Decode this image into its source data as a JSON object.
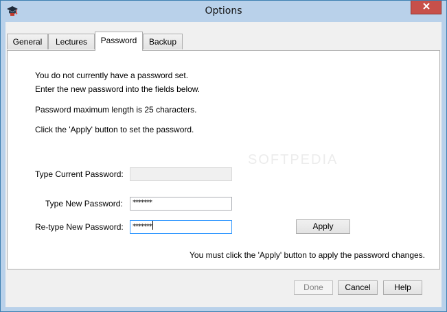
{
  "window": {
    "title": "Options",
    "close_icon": "close-icon",
    "app_icon": "graduation-cap-icon"
  },
  "tabs": [
    {
      "label": "General",
      "active": false
    },
    {
      "label": "Lectures",
      "active": false
    },
    {
      "label": "Password",
      "active": true
    },
    {
      "label": "Backup",
      "active": false
    }
  ],
  "password_page": {
    "info_line1": "You do not currently have a password set.",
    "info_line2": "Enter the new password into the fields below.",
    "max_length_note": "Password maximum length is 25 characters.",
    "apply_instruction": "Click the 'Apply' button to set the password.",
    "current_password_label": "Type Current Password:",
    "current_password_value": "",
    "new_password_label": "Type New Password:",
    "new_password_value": "*******",
    "retype_password_label": "Re-type New Password:",
    "retype_password_value": "*******",
    "apply_button": "Apply",
    "apply_note": "You must click the 'Apply' button to apply the password changes."
  },
  "footer": {
    "done_button": "Done",
    "cancel_button": "Cancel",
    "help_button": "Help"
  },
  "watermark": "SOFTPEDIA"
}
